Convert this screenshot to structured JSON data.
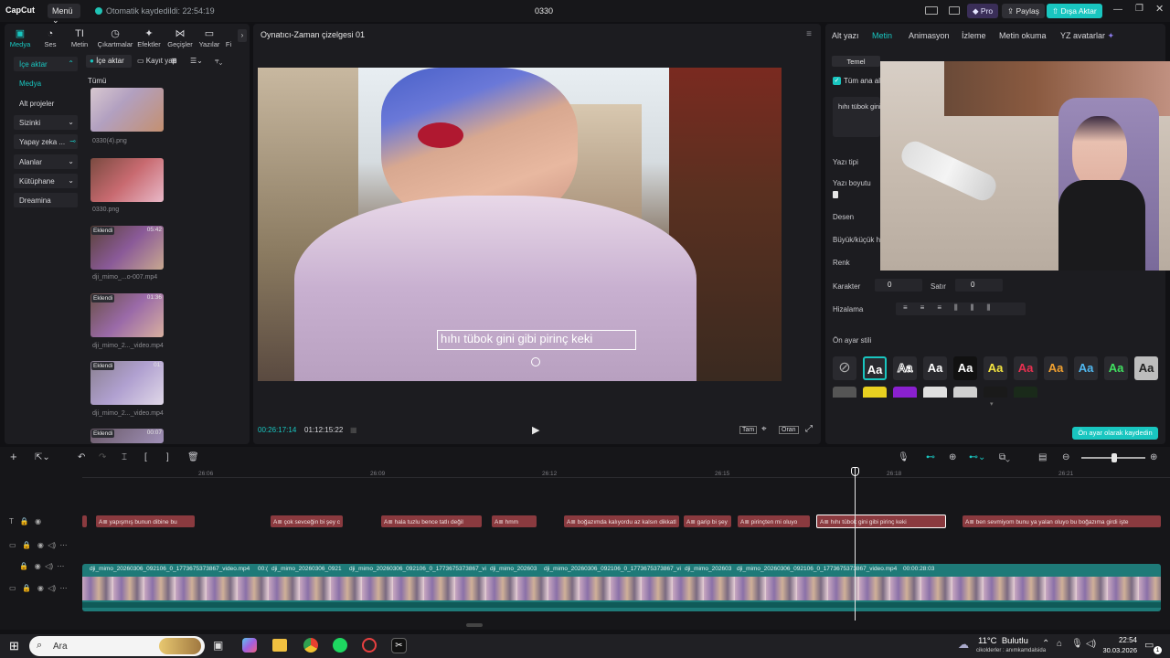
{
  "app": {
    "logo": "CapCut",
    "menu_label": "Menü ⌄",
    "autosave_text": "Otomatik kaydedildi: 22:54:19",
    "project_title": "0330"
  },
  "toolbar_right": {
    "pro_label": "Pro",
    "share_label": "Paylaş",
    "export_label": "Dışa Aktar"
  },
  "left_tools": [
    {
      "label": "Medya",
      "icon": "media-icon"
    },
    {
      "label": "Ses",
      "icon": "audio-icon"
    },
    {
      "label": "Metin",
      "icon": "text-icon"
    },
    {
      "label": "Çıkartmalar",
      "icon": "sticker-icon"
    },
    {
      "label": "Efektler",
      "icon": "effects-icon"
    },
    {
      "label": "Geçişler",
      "icon": "transitions-icon"
    },
    {
      "label": "Yazılar",
      "icon": "captions-icon"
    },
    {
      "label": "Fi",
      "icon": "filter-icon"
    }
  ],
  "left_nav": [
    {
      "label": "İçe aktar",
      "caret": "⌃"
    },
    {
      "label": "Medya",
      "caret": ""
    },
    {
      "label": "Alt projeler",
      "caret": ""
    },
    {
      "label": "Sizinki",
      "caret": "⌄"
    },
    {
      "label": "Yapay zeka ...",
      "caret": "⌄"
    },
    {
      "label": "Alanlar",
      "caret": "⌄"
    },
    {
      "label": "Kütüphane",
      "caret": "⌄"
    },
    {
      "label": "Dreamina",
      "caret": ""
    }
  ],
  "media_toolbar": {
    "import_label": "İçe aktar",
    "record_label": "Kayıt yap"
  },
  "media_section_title": "Tümü",
  "media_items": [
    {
      "name": "0330(4).png",
      "badge": "",
      "duration": ""
    },
    {
      "name": "0330.png",
      "badge": "",
      "duration": ""
    },
    {
      "name": "dji_mimo_...o-007.mp4",
      "badge": "Eklendi",
      "duration": "05:42"
    },
    {
      "name": "dji_mimo_2..._video.mp4",
      "badge": "Eklendi",
      "duration": "01:36"
    },
    {
      "name": "dji_mimo_2..._video.mp4",
      "badge": "Eklendi",
      "duration": "01:"
    },
    {
      "name": "",
      "badge": "Eklendi",
      "duration": "00:07"
    }
  ],
  "player": {
    "title": "Oynatıcı-Zaman çizelgesi 01",
    "subtitle_text": "hıhı tübok gini gibi pirinç keki",
    "current_time": "00:26:17:14",
    "total_time": "01:12:15:22",
    "full_label": "Tam",
    "ratio_label": "Oran"
  },
  "right_tabs": [
    {
      "label": "Alt yazı",
      "active": false
    },
    {
      "label": "Metin",
      "active": true
    },
    {
      "label": "Animasyon",
      "active": false
    },
    {
      "label": "İzleme",
      "active": false
    },
    {
      "label": "Metin okuma",
      "active": false
    },
    {
      "label": "YZ avatarlar",
      "active": false
    }
  ],
  "text_panel": {
    "subtab_basic": "Temel",
    "apply_all_label": "Tüm ana alt",
    "text_preview": "hıhı tübok gini",
    "font_label": "Yazı tipi",
    "size_label": "Yazı boyutu",
    "pattern_label": "Desen",
    "case_label": "Büyük/küçük h",
    "color_label": "Renk",
    "char_label": "Karakter",
    "char_value": "0",
    "line_label": "Satır",
    "line_value": "0",
    "align_label": "Hizalama",
    "preset_label": "Ön ayar stili",
    "save_preset_label": "Ön ayar olarak kaydedin",
    "preset_glyph": "Aa"
  },
  "timeline": {
    "ruler": [
      "26:06",
      "26:09",
      "26:12",
      "26:15",
      "26:18",
      "26:21"
    ],
    "text_clips": [
      "yapışmış bunun dibine bu",
      "çok sevceğin bi şey c",
      "hala tuzlu bence tatlı değil",
      "hmm",
      "boğazımda kalıyordu az kalsın dikkatl",
      "garip bi şey",
      "pirinçten mi oluyo",
      "hıhı tübok gini gibi pirinç keki",
      "ben sevmiyom bunu ya yalan oluyo bu boğazıma girdi işte"
    ],
    "video_clips": [
      "dji_mimo_20260306_092106_0_1773675373867_video.mp4",
      "00:(",
      "dji_mimo_20260306_0921",
      "dji_mimo_20260306_092106_0_1773675373867_vi",
      "dji_mimo_202603",
      "dji_mimo_20260306_092106_0_1773675373867_vi",
      "dji_mimo_202603",
      "dji_mimo_20260306_092106_0_1773675373867_video.mp4",
      "00:00:28:03"
    ],
    "text_prefix": "A≣"
  },
  "taskbar": {
    "search_placeholder": "Ara",
    "weather_temp": "11°C",
    "weather_desc": "Bulutlu",
    "ticker": "cikolderler : anımkamdalsida",
    "time": "22:54",
    "date": "30.03.2026",
    "notif_count": "1"
  },
  "colors": {
    "accent": "#19c6c0",
    "text_clip": "#8a3a3f",
    "video_clip": "#1e7a78",
    "export": "#19c6c0"
  }
}
